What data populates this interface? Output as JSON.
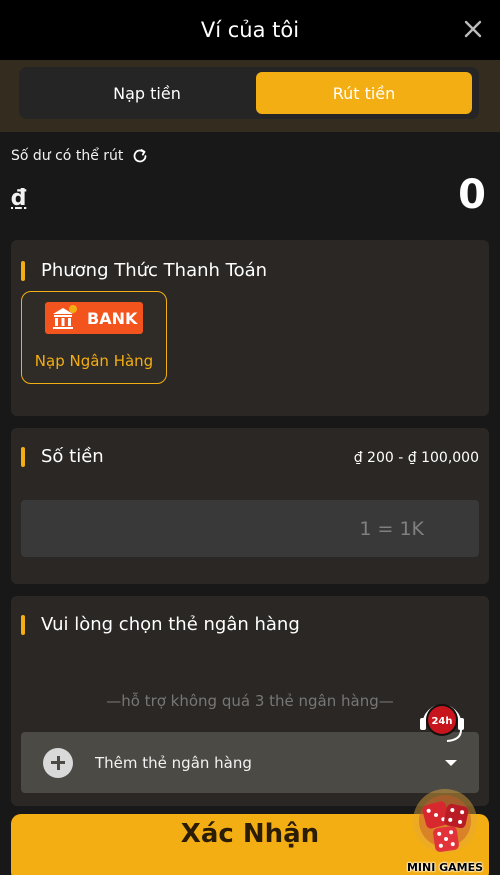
{
  "header": {
    "title": "Ví của tôi",
    "close_icon": "close-icon"
  },
  "tabs": [
    {
      "label": "Nạp tiền",
      "active": false
    },
    {
      "label": "Rút tiền",
      "active": true
    }
  ],
  "balance": {
    "label": "Số dư có thể rút",
    "currency": "₫",
    "value": "0",
    "refresh_icon": "refresh-icon"
  },
  "payment_method": {
    "title": "Phương Thức Thanh Toán",
    "option": {
      "logo_text": "BANK",
      "label": "Nạp Ngân Hàng",
      "selected": true
    }
  },
  "amount": {
    "title": "Số tiền",
    "range": "₫ 200 - ₫ 100,000",
    "placeholder": "1 = 1K"
  },
  "bank_card": {
    "title": "Vui lòng chọn thẻ ngân hàng",
    "hint": "—hỗ trợ không quá 3 thẻ ngân hàng—",
    "add_label": "Thêm thẻ ngân hàng"
  },
  "confirm_label": "Xác Nhận",
  "mini_games_label": "MINI GAMES",
  "support_badge": "24h",
  "colors": {
    "accent": "#f3ae13",
    "bank_logo": "#f3541d",
    "background": "#181818"
  }
}
